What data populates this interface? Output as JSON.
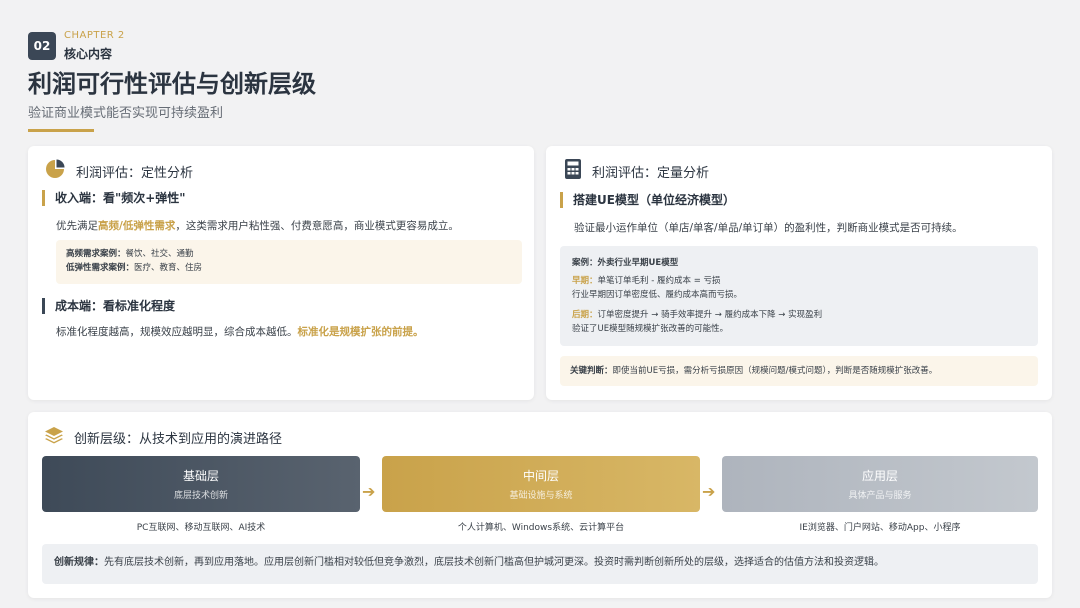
{
  "header": {
    "chapter_num": "02",
    "chapter_en": "CHAPTER 2",
    "chapter_cn": "核心内容",
    "title": "利润可行性评估与创新层级",
    "subtitle": "验证商业模式能否实现可持续盈利"
  },
  "qualitative": {
    "title": "利润评估：定性分析",
    "icon": "pie-chart-icon",
    "revenue": {
      "title": "收入端：看\"频次+弹性\"",
      "text_a": "优先满足",
      "text_hl": "高频/低弹性需求",
      "text_b": "，这类需求用户粘性强、付费意愿高，商业模式更容易成立。",
      "example_1_label": "高频需求案例：",
      "example_1_value": "餐饮、社交、通勤",
      "example_2_label": "低弹性需求案例：",
      "example_2_value": "医疗、教育、住房"
    },
    "cost": {
      "title": "成本端：看标准化程度",
      "text_a": "标准化程度越高，规模效应越明显，综合成本越低。",
      "text_hl": "标准化是规模扩张的前提。"
    }
  },
  "quantitative": {
    "title": "利润评估：定量分析",
    "icon": "calculator-icon",
    "ue": {
      "title": "搭建UE模型（单位经济模型）",
      "text": "验证最小运作单位（单店/单客/单品/单订单）的盈利性，判断商业模式是否可持续。"
    },
    "case": {
      "title": "案例：外卖行业早期UE模型",
      "early_label": "早期：",
      "early_line1": "单笔订单毛利 - 履约成本 = 亏损",
      "early_line2": "行业早期因订单密度低、履约成本高而亏损。",
      "late_label": "后期：",
      "late_line1": "订单密度提升 → 骑手效率提升 → 履约成本下降 → 实现盈利",
      "late_line2": "验证了UE模型随规模扩张改善的可能性。"
    },
    "judgement": {
      "label": "关键判断：",
      "text": "即使当前UE亏损，需分析亏损原因（规模问题/模式问题），判断是否随规模扩张改善。"
    }
  },
  "innovation": {
    "title": "创新层级：从技术到应用的演进路径",
    "icon": "layers-icon",
    "layers": [
      {
        "name": "基础层",
        "desc": "底层技术创新",
        "caption": "PC互联网、移动互联网、AI技术",
        "color": "#3e4a58"
      },
      {
        "name": "中间层",
        "desc": "基础设施与系统",
        "caption": "个人计算机、Windows系统、云计算平台",
        "color": "#c9a24a"
      },
      {
        "name": "应用层",
        "desc": "具体产品与服务",
        "caption": "IE浏览器、门户网站、移动App、小程序",
        "color": "#aeb4bd"
      }
    ],
    "rule_label": "创新规律：",
    "rule_text": "先有底层技术创新，再到应用落地。应用层创新门槛相对较低但竞争激烈，底层技术创新门槛高但护城河更深。投资时需判断创新所处的层级，选择适合的估值方法和投资逻辑。"
  },
  "colors": {
    "accent": "#c9a24a",
    "dark": "#3b4756"
  }
}
